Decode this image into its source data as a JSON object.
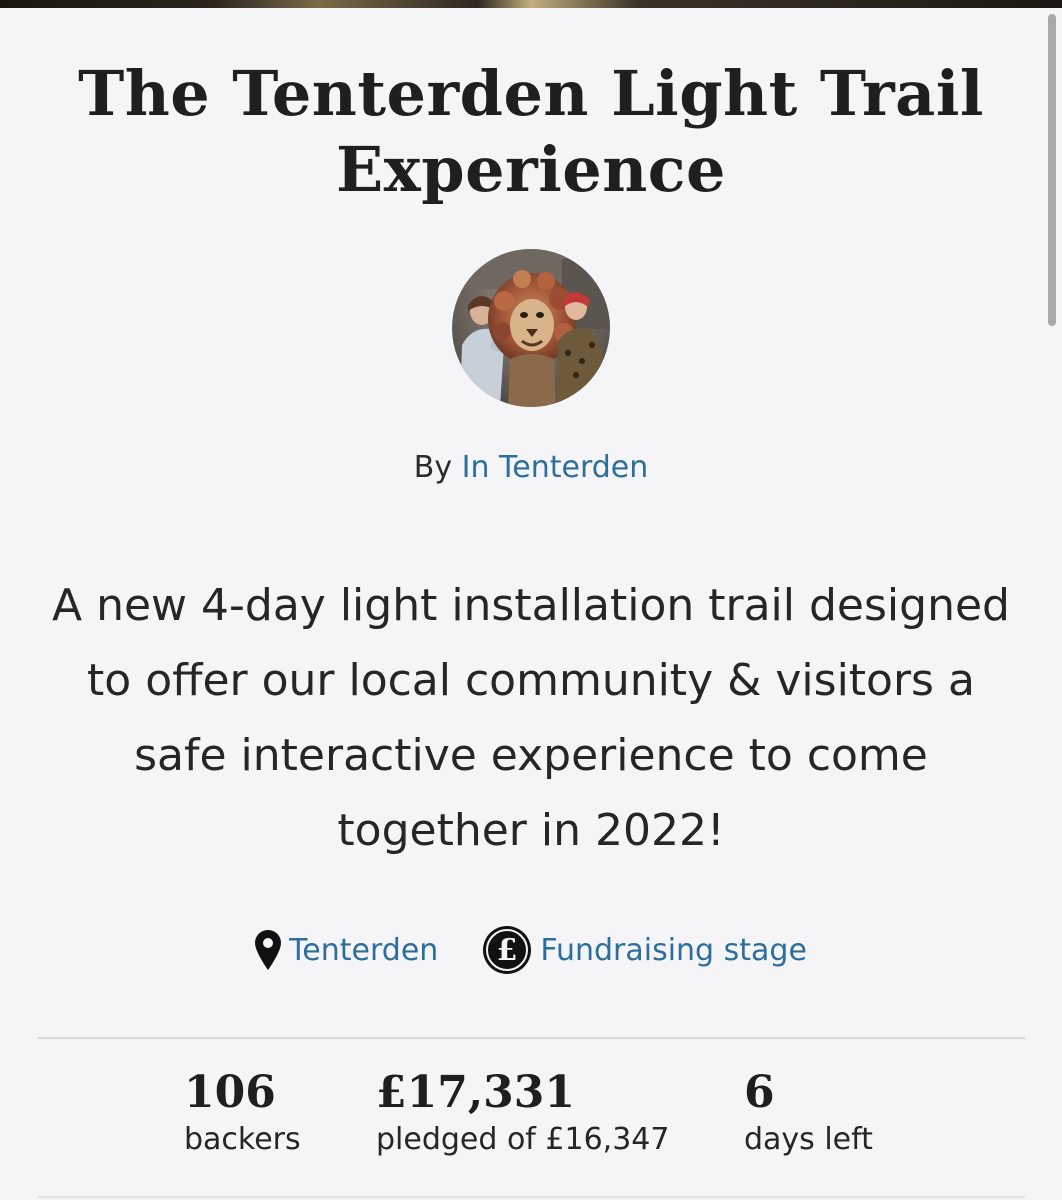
{
  "project": {
    "title": "The Tenterden Light Trail Experience",
    "by_prefix": "By",
    "creator": "In Tenterden",
    "blurb": "A new 4-day light installation trail designed to offer our local community & visitors a safe interactive experience to come together in 2022!",
    "location": "Tenterden",
    "stage": "Fundraising stage"
  },
  "stats": {
    "backers": {
      "value": "106",
      "label": "backers"
    },
    "pledged": {
      "value": "£17,331",
      "label": "pledged of £16,347"
    },
    "days_left": {
      "value": "6",
      "label": "days left"
    }
  },
  "icons": {
    "location": "map-pin-icon",
    "stage": "pound-circle-icon"
  },
  "colors": {
    "link": "#2d6f9c",
    "text": "#1f1f1f",
    "background": "#f5f5f7"
  }
}
